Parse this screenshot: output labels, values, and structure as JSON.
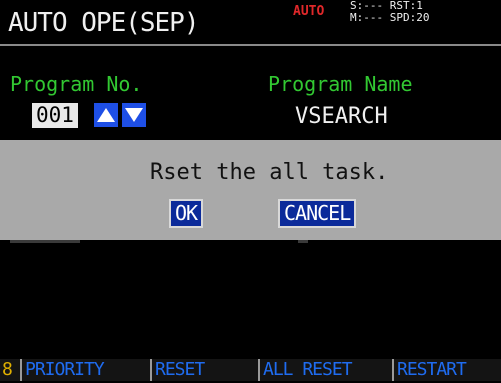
{
  "header": {
    "title": "AUTO OPE(SEP)",
    "mode_badge": "AUTO",
    "status_lines": [
      "S:--- RST:1",
      "M:--- SPD:20"
    ]
  },
  "program": {
    "number_label": "Program No.",
    "number_value": "001",
    "name_label": "Program Name",
    "name_value": "VSEARCH"
  },
  "dialog": {
    "message": "Rset the all task.",
    "ok_label": "OK",
    "cancel_label": "CANCEL"
  },
  "function_keys": {
    "f8_label": "8",
    "priority_label": "PRIORITY",
    "reset_label": "RESET",
    "all_reset_label": "ALL RESET",
    "restart_label": "RESTART"
  },
  "colors": {
    "label_green": "#32c832",
    "auto_red": "#e0282a",
    "key_blue": "#1f6cf0",
    "dialog_gray": "#a9a9a9"
  }
}
